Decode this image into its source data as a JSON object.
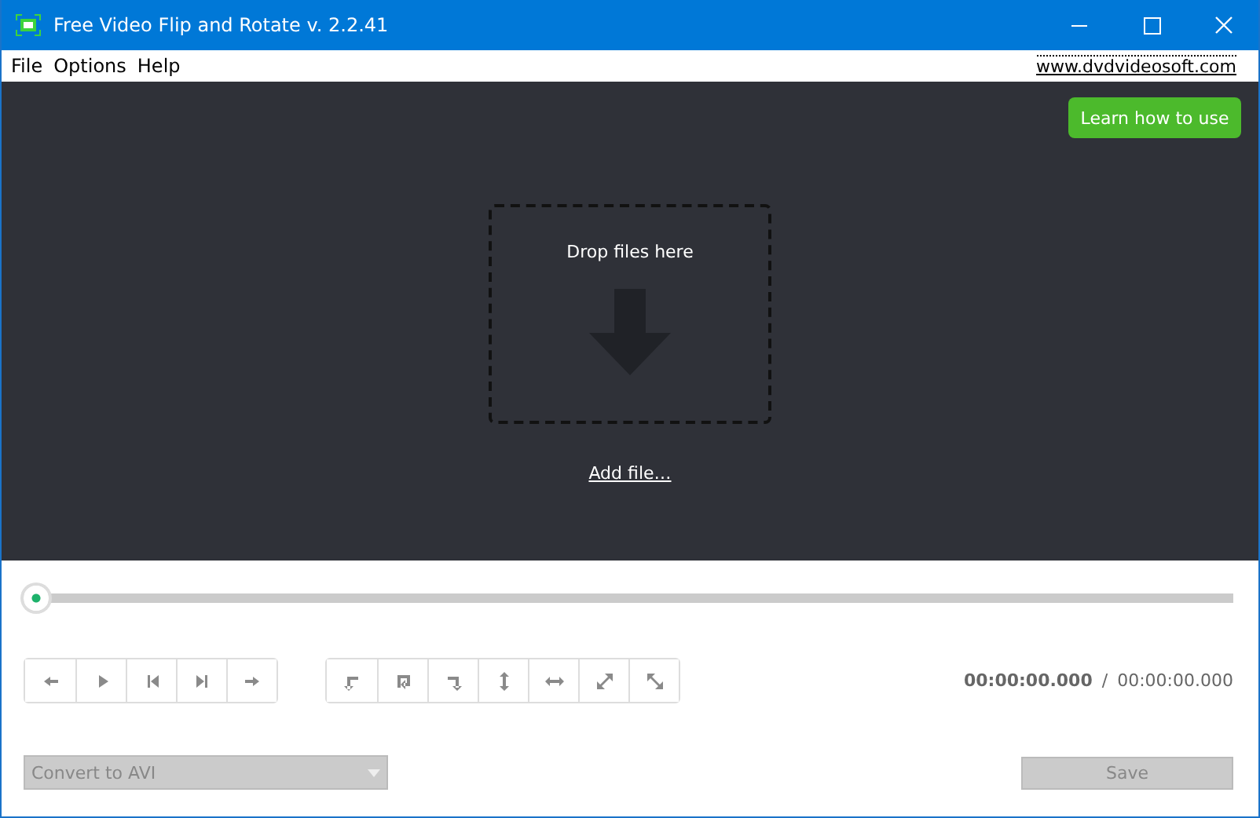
{
  "window": {
    "title": "Free Video Flip and Rotate v. 2.2.41"
  },
  "menu": [
    {
      "label": "File"
    },
    {
      "label": "Options"
    },
    {
      "label": "Help"
    }
  ],
  "website_link": "www.dvdvideosoft.com",
  "learn_button": "Learn how to use",
  "drop_zone": {
    "label": "Drop files here",
    "add_link": "Add file…"
  },
  "seek_slider": {
    "level": 0
  },
  "time": {
    "current": "00:00:00.000",
    "separator": "/",
    "total": "00:00:00.000"
  },
  "format_select": {
    "value": "Convert to AVI",
    "disabled": true
  },
  "save_button": {
    "label": "Save",
    "disabled": true
  }
}
